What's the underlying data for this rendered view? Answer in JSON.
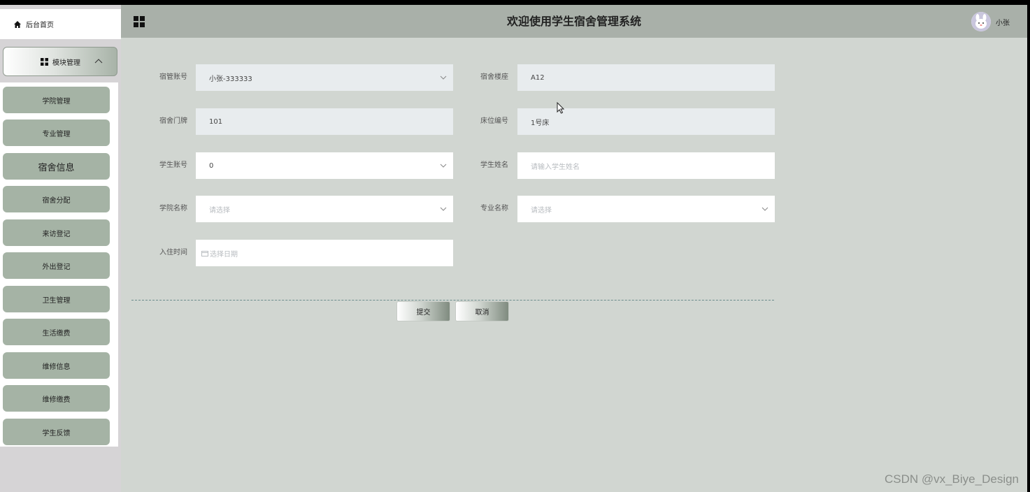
{
  "header": {
    "title": "欢迎使用学生宿舍管理系统",
    "username": "小张",
    "menu_icon": "grid-icon",
    "avatar_icon": "avatar-icon"
  },
  "sidebar": {
    "home_label": "后台首页",
    "module_label": "模块管理",
    "items": [
      {
        "label": "学院管理"
      },
      {
        "label": "专业管理"
      },
      {
        "label": "宿舍信息"
      },
      {
        "label": "宿舍分配"
      },
      {
        "label": "来访登记"
      },
      {
        "label": "外出登记"
      },
      {
        "label": "卫生管理"
      },
      {
        "label": "生活缴费"
      },
      {
        "label": "维修信息"
      },
      {
        "label": "维修缴费"
      },
      {
        "label": "学生反馈"
      }
    ]
  },
  "form": {
    "dorm_manager": {
      "label": "宿管账号",
      "value": "小张-333333"
    },
    "building": {
      "label": "宿舍楼座",
      "value": "A12"
    },
    "door": {
      "label": "宿舍门牌",
      "value": "101"
    },
    "bed": {
      "label": "床位编号",
      "value": "1号床"
    },
    "student_account": {
      "label": "学生账号",
      "value": "0"
    },
    "student_name": {
      "label": "学生姓名",
      "placeholder": "请输入学生姓名"
    },
    "college": {
      "label": "学院名称",
      "placeholder": "请选择"
    },
    "major": {
      "label": "专业名称",
      "placeholder": "请选择"
    },
    "checkin": {
      "label": "入住时间",
      "placeholder": "选择日期"
    }
  },
  "buttons": {
    "submit": "提交",
    "cancel": "取消"
  },
  "watermark": "CSDN @vx_Biye_Design",
  "colors": {
    "header_bg": "#a9b0a9",
    "content_bg": "#d1d6d1",
    "menu_item_bg": "#a5b3a5",
    "disabled_field_bg": "#e8ecee"
  }
}
